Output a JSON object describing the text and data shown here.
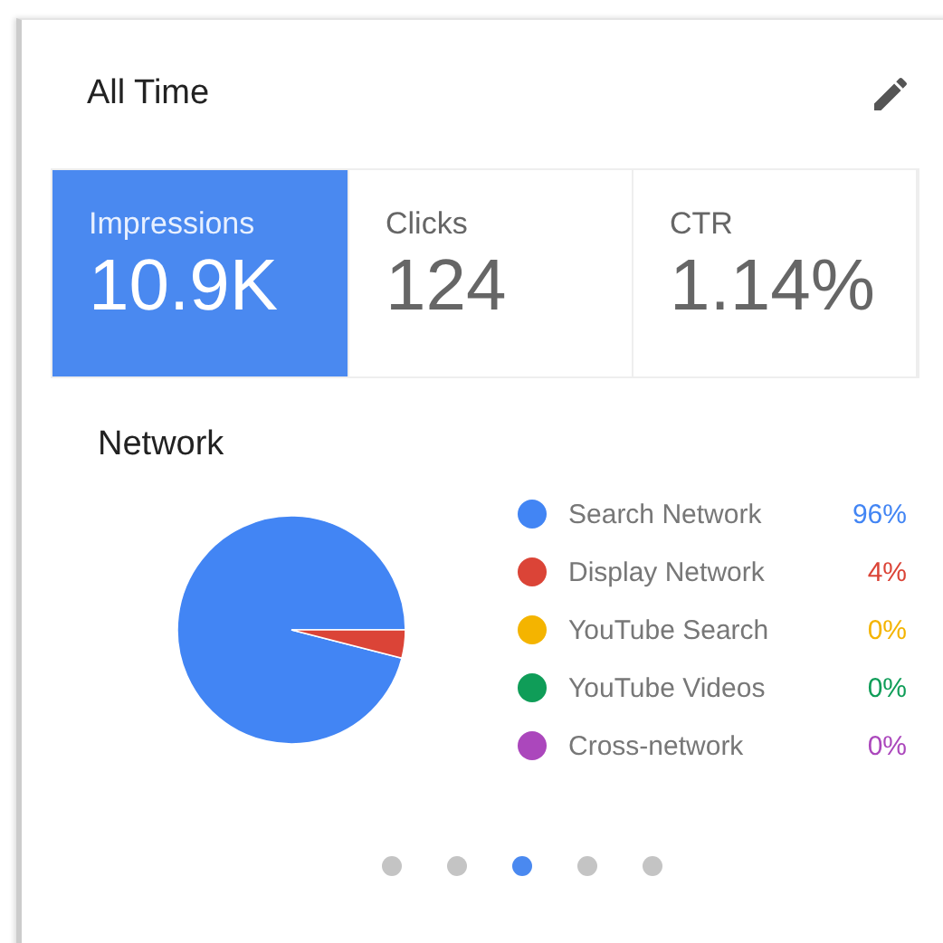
{
  "header": {
    "title": "All Time"
  },
  "metrics": [
    {
      "label": "Impressions",
      "value": "10.9K",
      "selected": true
    },
    {
      "label": "Clicks",
      "value": "124",
      "selected": false
    },
    {
      "label": "CTR",
      "value": "1.14%",
      "selected": false
    }
  ],
  "network": {
    "title": "Network",
    "legend": [
      {
        "percent": "96%",
        "color": "#4285f4"
      },
      {
        "percent": "4%",
        "color": "#db4437"
      },
      {
        "percent": "0%",
        "color": "#f4b400"
      },
      {
        "percent": "0%",
        "color": "#0f9d58"
      },
      {
        "percent": "0%",
        "color": "#ab47bc"
      }
    ],
    "chart_data": {
      "type": "pie",
      "categories": [
        "Search Network",
        "Display Network",
        "YouTube Search",
        "YouTube Videos",
        "Cross-network"
      ],
      "values": [
        96,
        4,
        0,
        0,
        0
      ]
    }
  },
  "pager": [
    {
      "selected": false
    },
    {
      "selected": false
    },
    {
      "selected": true
    },
    {
      "selected": false
    },
    {
      "selected": false
    }
  ]
}
